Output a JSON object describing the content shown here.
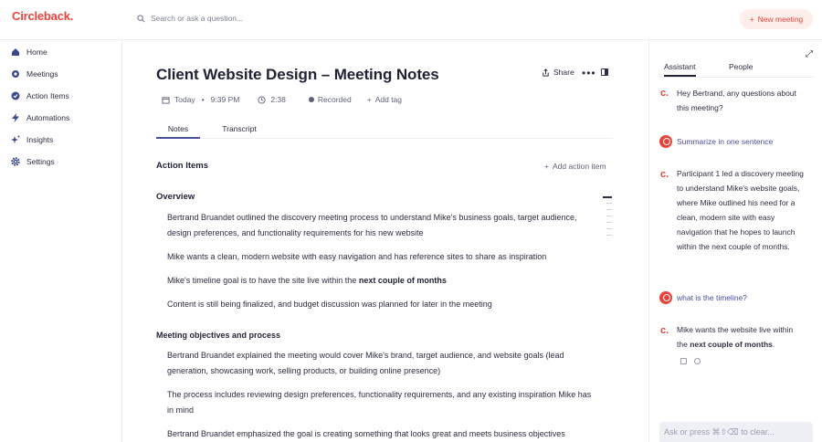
{
  "app": {
    "logo_text": "Circleback",
    "logo_dot": ".",
    "brand_color": "#e8443b"
  },
  "search": {
    "placeholder": "Search or ask a question..."
  },
  "header": {
    "new_meeting_label": "New meeting"
  },
  "sidebar": {
    "items": [
      {
        "label": "Home",
        "icon": "home-icon"
      },
      {
        "label": "Meetings",
        "icon": "meetings-icon"
      },
      {
        "label": "Action Items",
        "icon": "check-circle-icon"
      },
      {
        "label": "Automations",
        "icon": "bolt-icon"
      },
      {
        "label": "Insights",
        "icon": "sparkle-icon"
      },
      {
        "label": "Settings",
        "icon": "gear-icon"
      }
    ]
  },
  "meeting": {
    "title": "Client Website Design – Meeting Notes",
    "share_label": "Share",
    "more_label": "•••",
    "date": "Today",
    "time": "9:39 PM",
    "duration": "2:38",
    "recorded": "Recorded",
    "add_tag": "Add tag"
  },
  "tabs": [
    {
      "label": "Notes",
      "active": true
    },
    {
      "label": "Transcript",
      "active": false
    }
  ],
  "notes": {
    "action_items_heading": "Action Items",
    "add_action_item_label": "Add action item",
    "overview_heading": "Overview",
    "overview_bullets": [
      {
        "text": "Bertrand Bruandet outlined the discovery meeting process to understand Mike's business goals, target audience, design preferences, and functionality requirements for his new website"
      },
      {
        "text": "Mike wants a clean, modern website with easy navigation and has reference sites to share as inspiration"
      },
      {
        "text_before": "Mike's timeline goal is to have the site live within the ",
        "bold": "next couple of months"
      },
      {
        "text": "Content is still being finalized, and budget discussion was planned for later in the meeting"
      }
    ],
    "objectives_heading": "Meeting objectives and process",
    "objectives_bullets": [
      {
        "text": "Bertrand Bruandet explained the meeting would cover Mike's brand, target audience, and website goals (lead generation, showcasing work, selling products, or building online presence)"
      },
      {
        "text": "The process includes reviewing design preferences, functionality requirements, and any existing inspiration Mike has in mind"
      },
      {
        "text": "Bertrand Bruandet emphasized the goal is creating something that looks great and meets business objectives"
      }
    ]
  },
  "assistant": {
    "tabs": [
      {
        "label": "Assistant",
        "active": true
      },
      {
        "label": "People",
        "active": false
      }
    ],
    "messages": [
      {
        "role": "assistant",
        "text": "Hey Bertrand, any questions about this meeting?"
      },
      {
        "role": "user",
        "text": "Summarize in one sentence"
      },
      {
        "role": "assistant",
        "text": "Participant 1 led a discovery meeting to understand Mike's website goals, where Mike outlined his need for a clean, modern site with easy navigation that he hopes to launch within the next couple of months."
      },
      {
        "role": "user",
        "text": "what is the timeline?"
      },
      {
        "role": "assistant",
        "text_before": "Mike wants the website live within the ",
        "bold": "next couple of months",
        "text_after": "."
      }
    ],
    "input_placeholder": "Ask or press ⌘⇧⌫ to clear..."
  }
}
